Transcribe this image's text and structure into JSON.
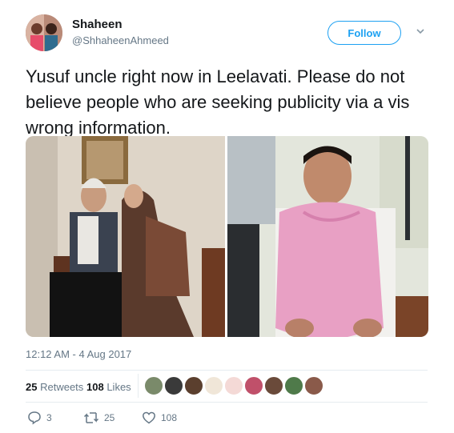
{
  "user": {
    "display_name": "Shaheen",
    "handle": "@ShhaheenAhmeed"
  },
  "follow_button": {
    "label": "Follow"
  },
  "tweet": {
    "text": "Yusuf uncle right now in Leelavati. Please do not believe people who are seeking publicity via a vis wrong information.",
    "timestamp": "12:12 AM - 4 Aug 2017"
  },
  "stats": {
    "retweets_count": "25",
    "retweets_label": "Retweets",
    "likes_count": "108",
    "likes_label": "Likes"
  },
  "actions": {
    "reply_count": "3",
    "retweet_count": "25",
    "like_count": "108"
  },
  "colors": {
    "accent": "#1da1f2",
    "secondary_text": "#657786",
    "divider": "#e6ecf0"
  },
  "icons": [
    "reply-icon",
    "retweet-icon",
    "heart-icon",
    "chevron-down-icon"
  ]
}
